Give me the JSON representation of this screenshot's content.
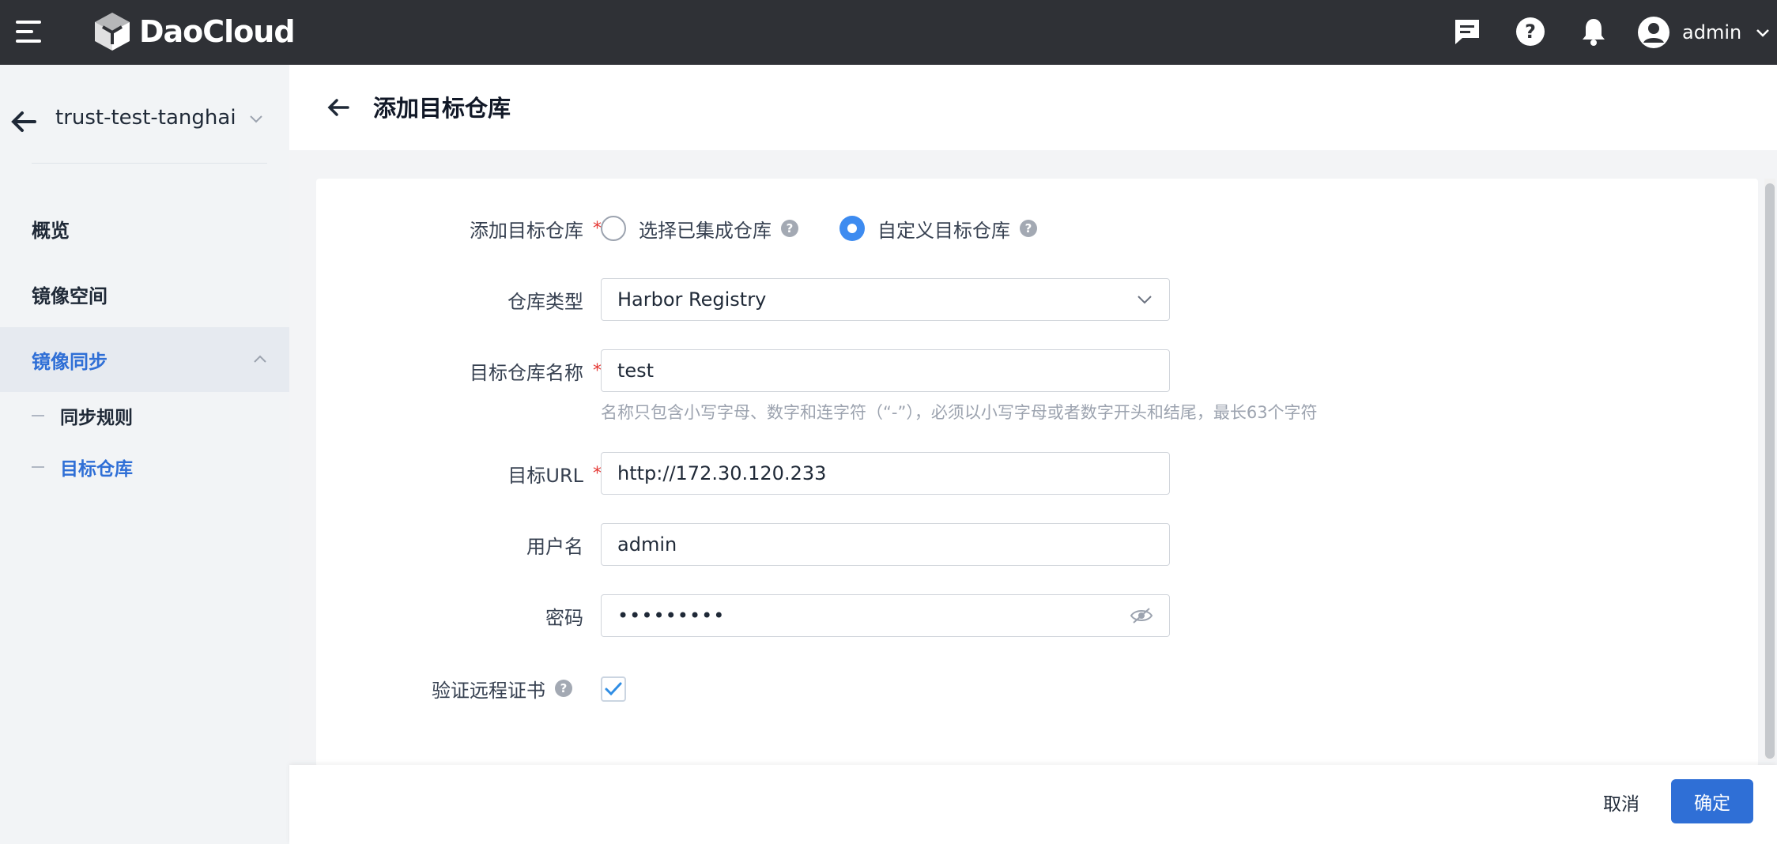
{
  "app": {
    "logo_text": "DaoCloud"
  },
  "topbar": {
    "icons": [
      "message-icon",
      "help-icon",
      "bell-icon"
    ],
    "user": {
      "name": "admin"
    }
  },
  "sidebar": {
    "workspace_name": "trust-test-tanghai",
    "items": [
      {
        "label": "概览"
      },
      {
        "label": "镜像空间"
      },
      {
        "label": "镜像同步",
        "expanded": true
      }
    ],
    "subitems": [
      {
        "label": "同步规则"
      },
      {
        "label": "目标仓库",
        "active": true
      }
    ]
  },
  "header": {
    "title": "添加目标仓库"
  },
  "form": {
    "target_registry": {
      "label": "添加目标仓库",
      "options": [
        {
          "label": "选择已集成仓库",
          "selected": false
        },
        {
          "label": "自定义目标仓库",
          "selected": true
        }
      ]
    },
    "registry_type": {
      "label": "仓库类型",
      "value": "Harbor Registry"
    },
    "registry_name": {
      "label": "目标仓库名称",
      "value": "test",
      "hint": "名称只包含小写字母、数字和连字符（“-”），必须以小写字母或者数字开头和结尾，最长63个字符"
    },
    "target_url": {
      "label": "目标URL",
      "value": "http://172.30.120.233"
    },
    "username": {
      "label": "用户名",
      "value": "admin"
    },
    "password": {
      "label": "密码",
      "value": "•••••••••"
    },
    "verify_cert": {
      "label": "验证远程证书",
      "checked": true
    }
  },
  "footer": {
    "cancel_label": "取消",
    "ok_label": "确定"
  },
  "colors": {
    "accent": "#2f6fd6",
    "topbar": "#2f3136",
    "radio_checked": "#3d8bf0",
    "required": "#e53935"
  }
}
